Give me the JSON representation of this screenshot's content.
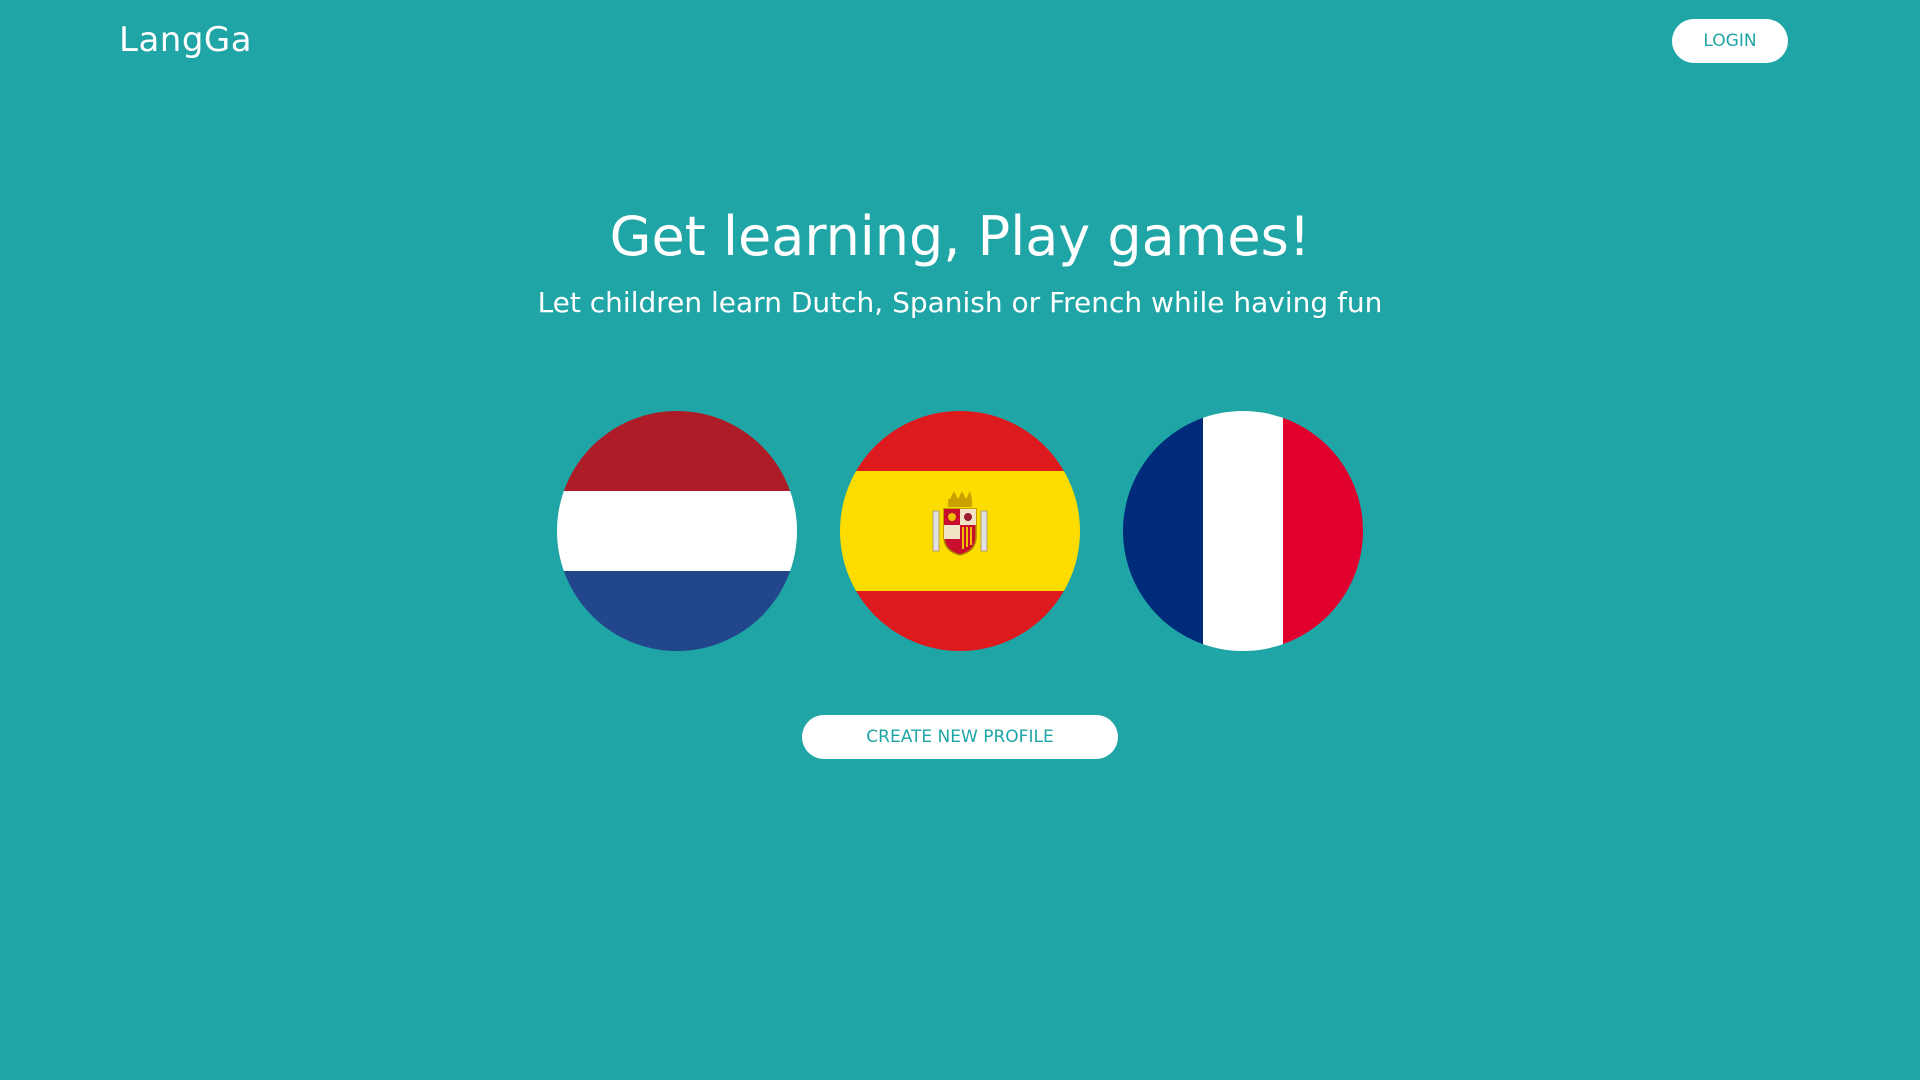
{
  "header": {
    "logo": "LangGa",
    "login_label": "LOGIN"
  },
  "hero": {
    "title": "Get learning, Play games!",
    "subtitle": "Let children learn Dutch, Spanish or French while having fun"
  },
  "flags": [
    {
      "icon": "netherlands-flag-icon",
      "colors": [
        "#ae1c28",
        "#ffffff",
        "#21468b"
      ]
    },
    {
      "icon": "spain-flag-icon",
      "colors": [
        "#dd1a1d",
        "#fddd00",
        "#dd1a1d"
      ]
    },
    {
      "icon": "france-flag-icon",
      "colors": [
        "#002a7a",
        "#ffffff",
        "#e1002d"
      ]
    }
  ],
  "actions": {
    "create_profile_label": "CREATE NEW PROFILE"
  },
  "colors": {
    "background": "#1fa5a5",
    "button_background": "#ffffff",
    "button_text": "#1fa5a5"
  }
}
